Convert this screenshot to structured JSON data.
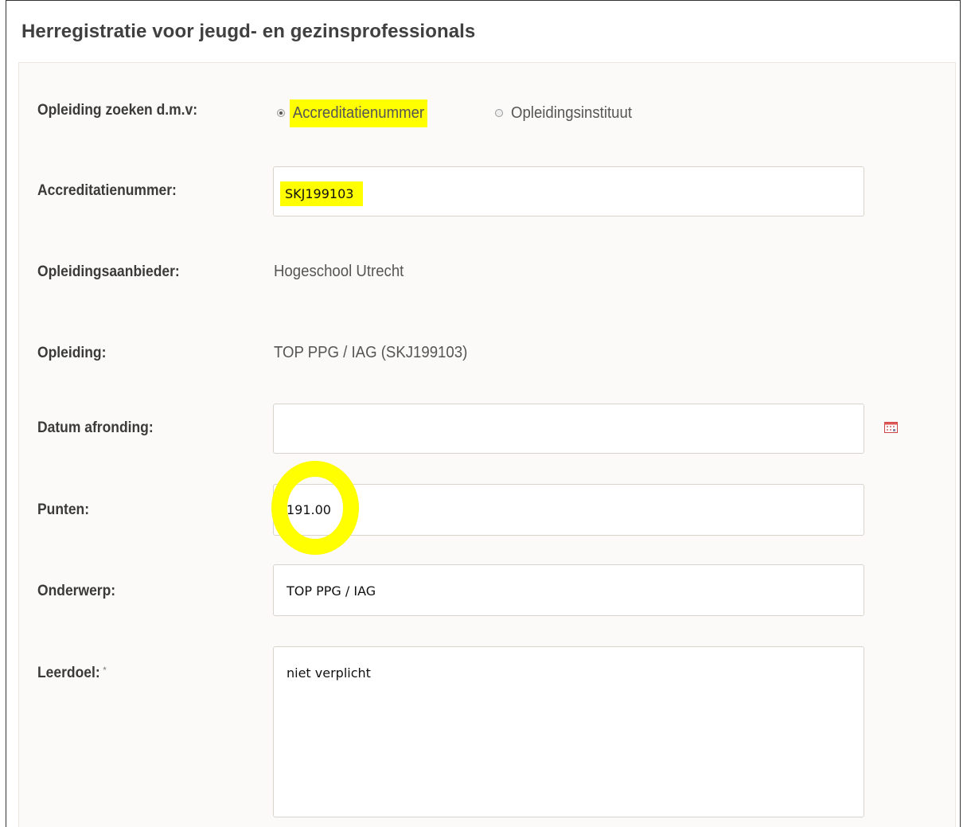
{
  "page": {
    "title": "Herregistratie voor jeugd- en gezinsprofessionals"
  },
  "form": {
    "search_by": {
      "label": "Opleiding zoeken d.m.v:",
      "options": [
        {
          "label": "Accreditatienummer",
          "selected": true
        },
        {
          "label": "Opleidingsinstituut",
          "selected": false
        }
      ]
    },
    "accreditation_number": {
      "label": "Accreditatienummer:",
      "value": "SKJ199103"
    },
    "provider": {
      "label": "Opleidingsaanbieder:",
      "value": "Hogeschool Utrecht"
    },
    "training": {
      "label": "Opleiding:",
      "value": "TOP PPG / IAG (SKJ199103)"
    },
    "completion_date": {
      "label": "Datum afronding:",
      "value": "",
      "icon": "calendar-icon"
    },
    "points": {
      "label": "Punten:",
      "value": "191.00"
    },
    "subject": {
      "label": "Onderwerp:",
      "value": "TOP PPG / IAG"
    },
    "learning_goal": {
      "label": "Leerdoel:",
      "required_mark": "*",
      "value": "niet verplicht"
    }
  },
  "colors": {
    "highlight": "#ffff00",
    "label_text": "#3a3a3a",
    "panel_bg": "#fbfaf8"
  }
}
